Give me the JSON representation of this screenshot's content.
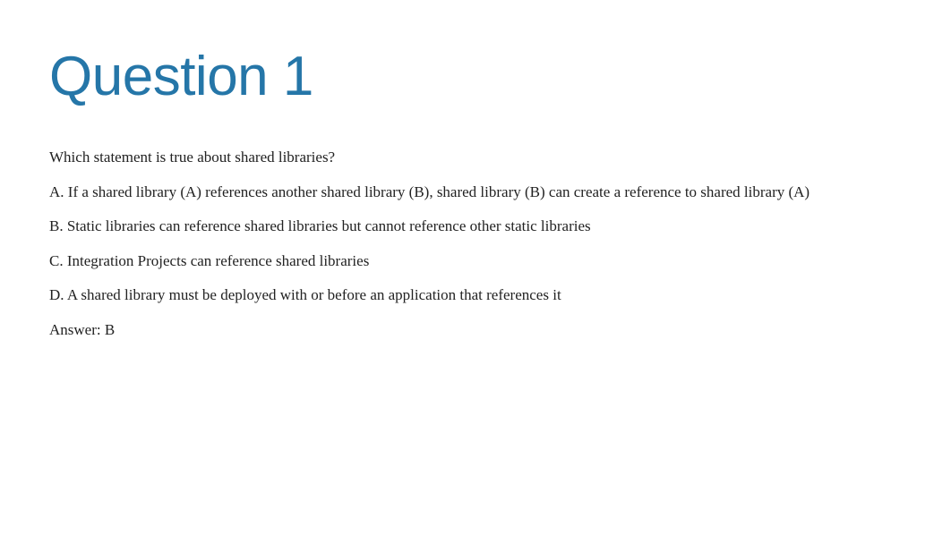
{
  "title": "Question 1",
  "prompt": "Which statement is true about shared libraries?",
  "options": {
    "a": "A. If a shared library (A) references another shared library (B), shared library (B) can create a reference to shared library (A)",
    "b": "B. Static libraries can reference shared libraries but cannot reference other static libraries",
    "c": "C. Integration Projects can reference shared libraries",
    "d": "D. A shared library must be deployed with or before an application that references it"
  },
  "answer": "Answer: B"
}
